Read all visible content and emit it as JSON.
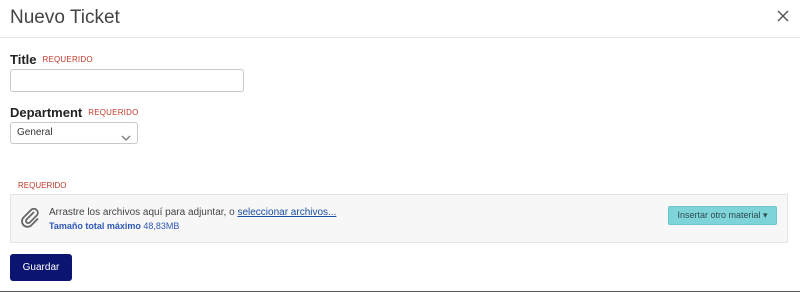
{
  "modal": {
    "title": "Nuevo Ticket"
  },
  "form": {
    "required_label": "REQUERIDO",
    "title_field": {
      "label": "Title",
      "value": "",
      "placeholder": ""
    },
    "department_field": {
      "label": "Department",
      "selected": "General"
    },
    "attachments": {
      "drop_text": "Arrastre los archivos aquí para adjuntar, o",
      "select_link": "seleccionar archivos...",
      "max_size_label": "Tamaño total máximo",
      "max_size_value": "48,83MB",
      "insert_button": "Insertar otro material"
    },
    "save_button": "Guardar"
  },
  "icons": {
    "close": "close-icon",
    "chevron": "chevron-down-icon",
    "attach": "paperclip-icon",
    "caret": "caret-down-icon"
  },
  "colors": {
    "required": "#c0392b",
    "primary": "#0b1470",
    "insert_button": "#7fd4d9",
    "link": "#1a4fa0"
  }
}
